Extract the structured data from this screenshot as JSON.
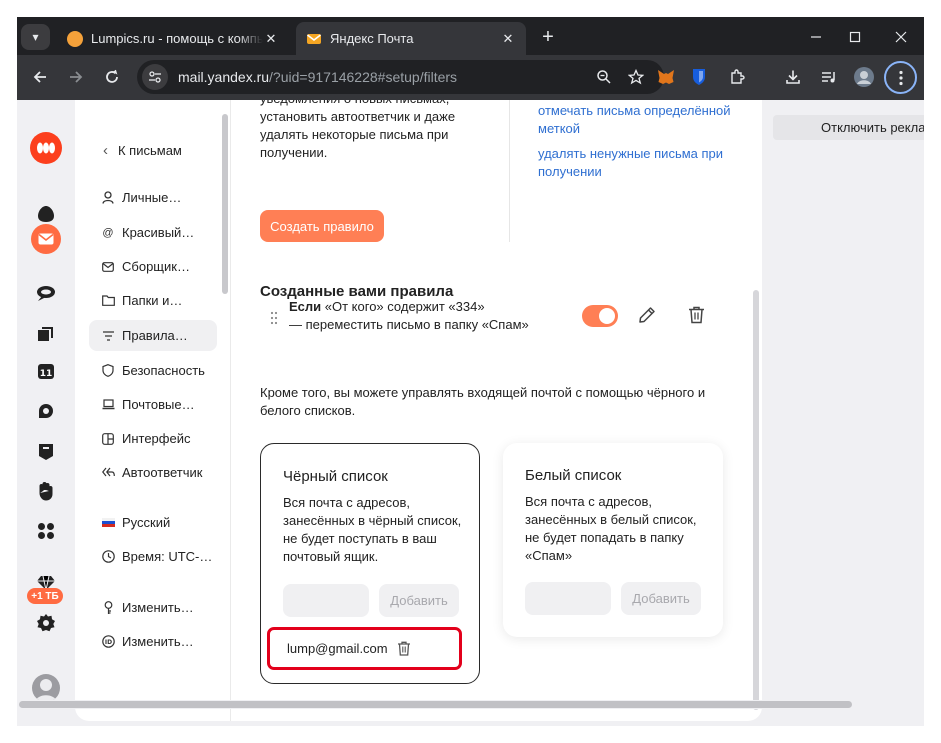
{
  "browser": {
    "tabs": [
      {
        "title": "Lumpics.ru - помощь с компьютером",
        "favicon_color": "#f4a13a",
        "active": false
      },
      {
        "title": "Яндекс Почта",
        "favicon_color": "#f5a623",
        "active": true
      }
    ],
    "url_host": "mail.yandex.ru",
    "url_path": "/?uid=917146228#setup/filters"
  },
  "nav": {
    "back_label": "К письмам",
    "items": [
      {
        "label": "Личные…"
      },
      {
        "label": "Красивый…"
      },
      {
        "label": "Сборщик…"
      },
      {
        "label": "Папки и…"
      },
      {
        "label": "Правила…"
      },
      {
        "label": "Безопасность"
      },
      {
        "label": "Почтовые…"
      },
      {
        "label": "Интерфейс"
      },
      {
        "label": "Автоответчик"
      },
      {
        "label": "Русский"
      },
      {
        "label": "Время: UTC-…"
      },
      {
        "label": "Изменить…"
      },
      {
        "label": "Изменить…"
      }
    ]
  },
  "rail": {
    "storage_badge": "+1 ТБ"
  },
  "filters": {
    "description": "уведомления о новых письмах, установить автоответчик и даже удалять некоторые письма при получении.",
    "links": [
      "отмечать письма определённой меткой",
      "удалять ненужные письма при получении"
    ],
    "create_button": "Создать правило",
    "rules_heading": "Созданные вами правила",
    "rule": {
      "if_word": "Если",
      "condition": " «От кого» содержит «334»",
      "action": "— переместить письмо в папку «Спам»",
      "enabled": true
    },
    "lists_description": "Кроме того, вы можете управлять входящей почтой с помощью чёрного и белого списков."
  },
  "blacklist": {
    "title": "Чёрный список",
    "description": "Вся почта с адресов, занесённых в чёрный список, не будет поступать в ваш почтовый ящик.",
    "input_value": "",
    "add_button": "Добавить",
    "entries": [
      "lump@gmail.com"
    ]
  },
  "whitelist": {
    "title": "Белый список",
    "description": "Вся почта с адресов, занесённых в белый список, не будет попадать в папку «Спам»",
    "input_value": "",
    "add_button": "Добавить"
  },
  "ads": {
    "disable_label": "Отключить реклам"
  },
  "colors": {
    "accent": "#ff7f55",
    "link": "#2f6fd1",
    "highlight_red": "#e3001b"
  }
}
